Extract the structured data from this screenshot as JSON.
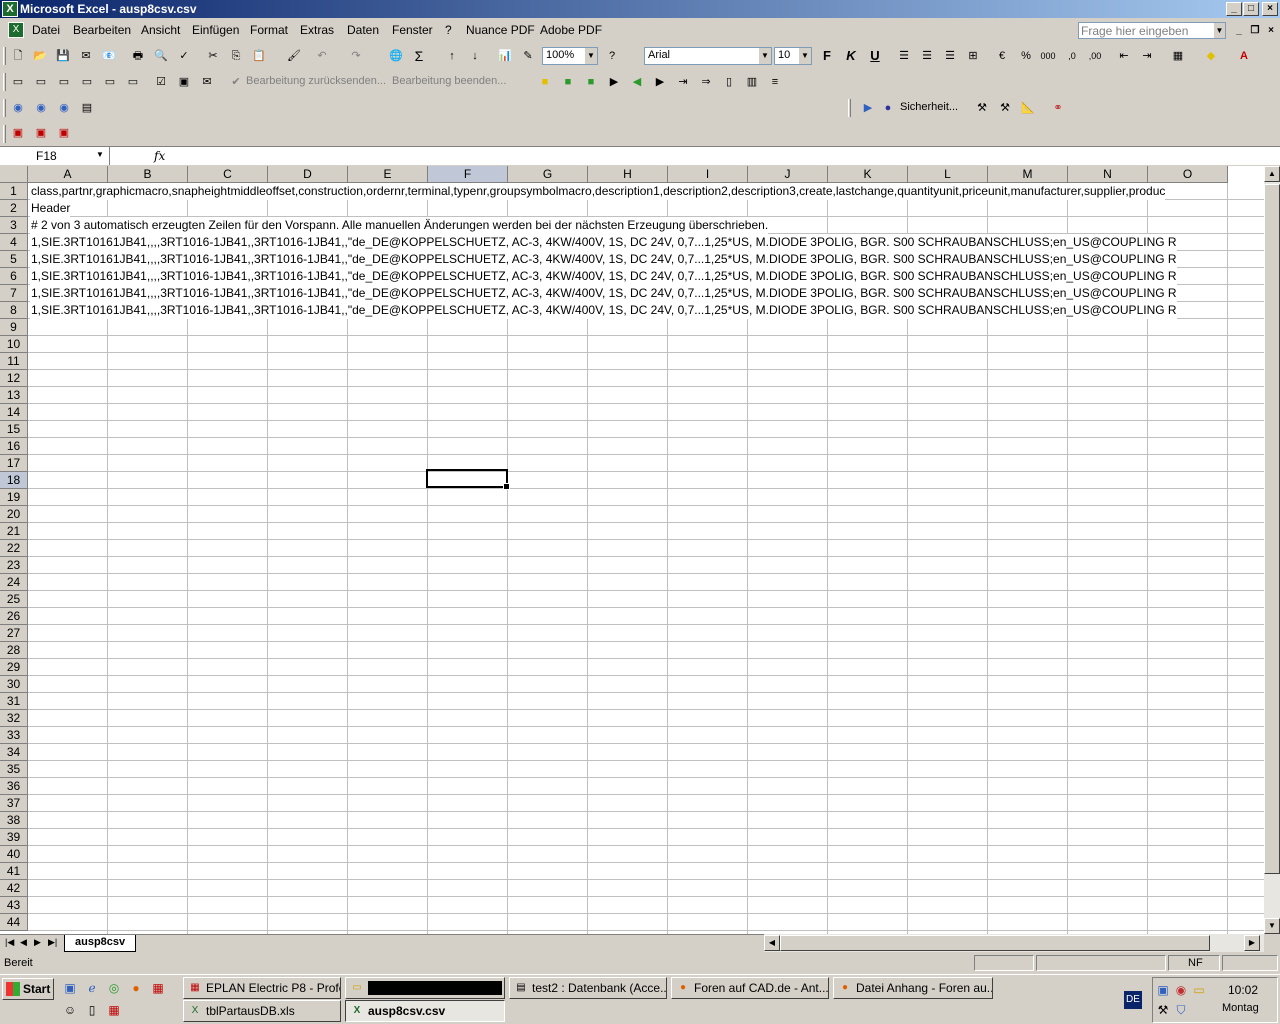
{
  "window": {
    "title": "Microsoft Excel - ausp8csv.csv",
    "min": "_",
    "max": "□",
    "close": "×"
  },
  "menu": {
    "items": [
      "Datei",
      "Bearbeiten",
      "Ansicht",
      "Einfügen",
      "Format",
      "Extras",
      "Daten",
      "Fenster",
      "?",
      "Nuance PDF",
      "Adobe PDF"
    ],
    "help_placeholder": "Frage hier eingeben"
  },
  "toolbar": {
    "zoom": "100%",
    "font": "Arial",
    "font_size": "10",
    "bold": "F",
    "italic": "K",
    "underline": "U",
    "review_back": "Bearbeitung zurücksenden...",
    "review_end": "Bearbeitung beenden...",
    "security": "Sicherheit..."
  },
  "formula_bar": {
    "name_box": "F18",
    "fx": "fx",
    "content": ""
  },
  "grid": {
    "columns": [
      "A",
      "B",
      "C",
      "D",
      "E",
      "F",
      "G",
      "H",
      "I",
      "J",
      "K",
      "L",
      "M",
      "N",
      "O"
    ],
    "selected_column": "F",
    "selected_row": 18,
    "row_count": 44,
    "rows": [
      "class,partnr,graphicmacro,snapheightmiddleoffset,construction,ordernr,terminal,typenr,groupsymbolmacro,description1,description2,description3,create,lastchange,quantityunit,priceunit,manufacturer,supplier,produc",
      "Header",
      "# 2 von 3 automatisch erzeugten Zeilen für den Vorspann. Alle manuellen Änderungen werden bei der nächsten Erzeugung überschrieben.",
      "1,SIE.3RT10161JB41,,,,3RT1016-1JB41,,3RT1016-1JB41,,\"de_DE@KOPPELSCHUETZ, AC-3, 4KW/400V, 1S, DC 24V, 0,7...1,25*US, M.DIODE 3POLIG, BGR. S00 SCHRAUBANSCHLUSS;en_US@COUPLING R",
      "1,SIE.3RT10161JB41,,,,3RT1016-1JB41,,3RT1016-1JB41,,\"de_DE@KOPPELSCHUETZ, AC-3, 4KW/400V, 1S, DC 24V, 0,7...1,25*US, M.DIODE 3POLIG, BGR. S00 SCHRAUBANSCHLUSS;en_US@COUPLING R",
      "1,SIE.3RT10161JB41,,,,3RT1016-1JB41,,3RT1016-1JB41,,\"de_DE@KOPPELSCHUETZ, AC-3, 4KW/400V, 1S, DC 24V, 0,7...1,25*US, M.DIODE 3POLIG, BGR. S00 SCHRAUBANSCHLUSS;en_US@COUPLING R",
      "1,SIE.3RT10161JB41,,,,3RT1016-1JB41,,3RT1016-1JB41,,\"de_DE@KOPPELSCHUETZ, AC-3, 4KW/400V, 1S, DC 24V, 0,7...1,25*US, M.DIODE 3POLIG, BGR. S00 SCHRAUBANSCHLUSS;en_US@COUPLING R",
      "1,SIE.3RT10161JB41,,,,3RT1016-1JB41,,3RT1016-1JB41,,\"de_DE@KOPPELSCHUETZ, AC-3, 4KW/400V, 1S, DC 24V, 0,7...1,25*US, M.DIODE 3POLIG, BGR. S00 SCHRAUBANSCHLUSS;en_US@COUPLING R"
    ]
  },
  "sheet_tab": "ausp8csv",
  "status": {
    "text": "Bereit",
    "nf": "NF"
  },
  "taskbar": {
    "start": "Start",
    "tasks": [
      "EPLAN Electric P8 - Profe...",
      "",
      "test2 : Datenbank (Acce...",
      "Foren auf CAD.de - Ant...",
      "Datei Anhang - Foren au...",
      "tblPartausDB.xls",
      "ausp8csv.csv"
    ],
    "lang": "DE",
    "time": "10:02",
    "day": "Montag"
  },
  "colors": {
    "title_start": "#0a246a",
    "title_end": "#a6caf0",
    "excel_green": "#1d6b2e",
    "selection": "#c0c8d8"
  }
}
